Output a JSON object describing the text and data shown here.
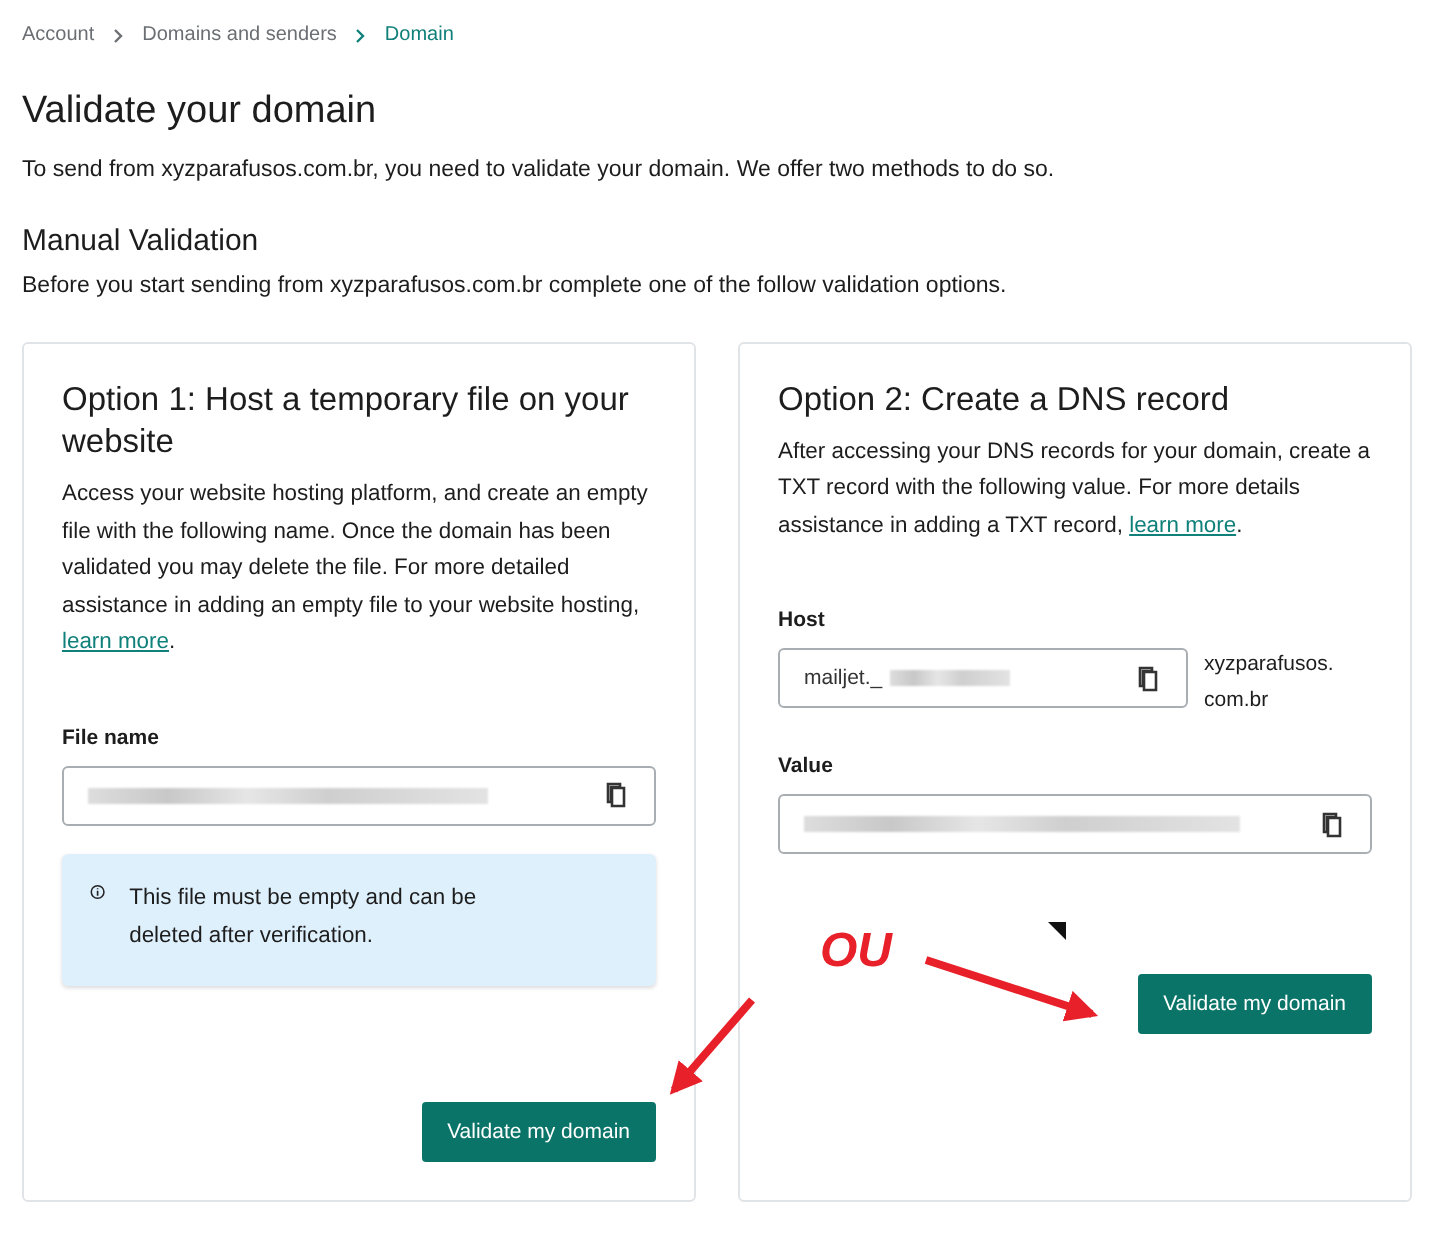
{
  "breadcrumb": [
    {
      "label": "Account",
      "current": false
    },
    {
      "label": "Domains and senders",
      "current": false
    },
    {
      "label": "Domain",
      "current": true
    }
  ],
  "title": "Validate your domain",
  "intro": "To send from xyzparafusos.com.br, you need to validate your domain. We offer two methods to do so.",
  "section": {
    "title": "Manual Validation",
    "description": "Before you start sending from xyzparafusos.com.br complete one of the follow validation options."
  },
  "options": [
    {
      "kind": "file",
      "title": "Option 1: Host a temporary file on your website",
      "description": "Access your website hosting platform, and create an empty file with the following name. Once the domain has been validated you may delete the file. For more detailed assistance in adding an empty file to your website hosting,",
      "link": "learn more",
      "link_end": ".",
      "fields": [
        {
          "label": "File name"
        }
      ],
      "note": "This file must be empty and can be deleted after verification.",
      "button": "Validate my domain"
    },
    {
      "kind": "dns",
      "title": "Option 2: Create a DNS record",
      "description": "After accessing your DNS records for your domain, create a TXT record with the following value. For more details assistance in adding a TXT record,",
      "link": "learn more",
      "link_end": ".",
      "fields": [
        {
          "label": "Host",
          "value": "mailjet._",
          "suffix": "xyzparafusos.\ncom.br"
        },
        {
          "label": "Value"
        }
      ],
      "button": "Validate my domain"
    }
  ],
  "annotation": {
    "label": "OU"
  }
}
